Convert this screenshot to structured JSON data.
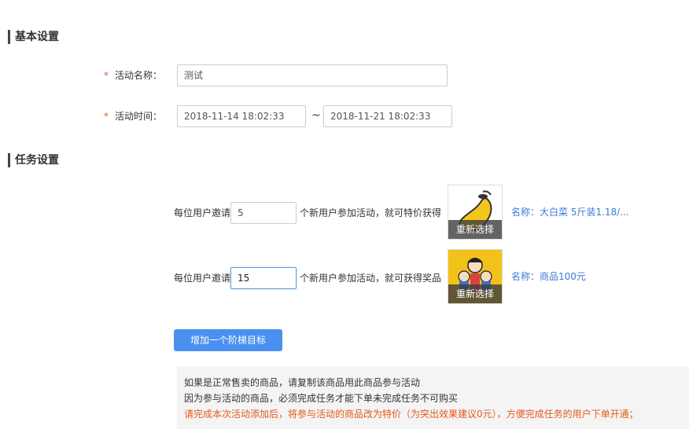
{
  "basic_settings": {
    "title": "基本设置",
    "name_label": "活动名称：",
    "name_value": "测试",
    "time_label": "活动时间：",
    "start_time": "2018-11-14 18:02:33",
    "separator": "~",
    "end_time": "2018-11-21 18:02:33",
    "required_mark": "*"
  },
  "task_settings": {
    "title": "任务设置",
    "tiers": [
      {
        "prefix": "每位用户邀请",
        "count": "5",
        "suffix": "个新用户参加活动，就可特价获得",
        "reselect_label": "重新选择",
        "product_name": "名称：大白菜 5斤装1.18/...",
        "image_icon": "mango-icon"
      },
      {
        "prefix": "每位用户邀请",
        "count": "15",
        "suffix": "个新用户参加活动，就可获得奖品",
        "reselect_label": "重新选择",
        "product_name": "名称：商品100元",
        "image_icon": "cartoon-people-icon"
      }
    ],
    "add_button": "增加一个阶梯目标"
  },
  "note": {
    "line1": "如果是正常售卖的商品，请复制该商品用此商品参与活动",
    "line2": "因为参与活动的商品，必须完成任务才能下单未完成任务不可购买",
    "line3": "请完成本次活动添加后，将参与活动的商品改为特价（为突出效果建议0元），方便完成任务的用户下单开通；",
    "warn_color": "#e55a1c"
  },
  "colors": {
    "accent": "#4a90f0",
    "link": "#3a7bd5",
    "required": "#e4572e"
  }
}
